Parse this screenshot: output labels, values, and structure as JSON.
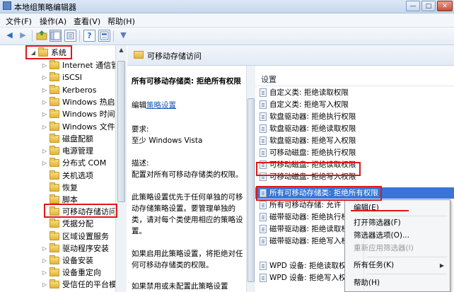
{
  "window": {
    "title": "本地组策略编辑器",
    "min": "—",
    "max": "□",
    "close": "✕"
  },
  "menu": [
    "文件(F)",
    "操作(A)",
    "查看(V)",
    "帮助(H)"
  ],
  "toolbar": {
    "back": "◀",
    "forward": "▶",
    "help": "?",
    "filter": "▼"
  },
  "tree": {
    "root": "系统",
    "items": [
      "Internet 通信管理",
      "iSCSI",
      "Kerberos",
      "Windows 热启动",
      "Windows 时间服务",
      "Windows 文件保护",
      "磁盘配额",
      "电源管理",
      "分布式 COM",
      "关机选项",
      "恢复",
      "脚本",
      "可移动存储访问",
      "凭据分配",
      "区域设置服务",
      "驱动程序安装",
      "设备安装",
      "设备重定向",
      "受信任的平台模块服务"
    ]
  },
  "header": {
    "title": "可移动存储访问"
  },
  "description": {
    "heading": "所有可移动存储类: 拒绝所有权限",
    "edit_prefix": "编辑",
    "edit_link": "策略设置",
    "req_label": "要求:",
    "req_value": "至少 Windows Vista",
    "desc_label": "描述:",
    "desc_text": "配置对所有可移动存储类的权限。",
    "para2": "此策略设置优先于任何单独的可移动存储策略设置。要管理单独的类，请对每个类使用相应的策略设置。",
    "para3": "如果启用此策略设置，将拒绝对任何可移动存储类的权限。",
    "para4": "如果禁用或未配置此策略设置"
  },
  "list": {
    "column": "设置",
    "rows": [
      "自定义类: 拒绝读取权限",
      "自定义类: 拒绝写入权限",
      "软盘驱动器: 拒绝执行权限",
      "软盘驱动器: 拒绝读取权限",
      "软盘驱动器: 拒绝写入权限",
      "可移动磁盘: 拒绝执行权限",
      "可移动磁盘: 拒绝读取权限",
      "可移动磁盘: 拒绝写入权限",
      "所有可移动存储类: 拒绝所有权限",
      "所有可移动存储: 允许",
      "磁带驱动器: 拒绝执行权限",
      "磁带驱动器: 拒绝读取权限",
      "磁带驱动器: 拒绝写入权限",
      "WPD 设备: 拒绝读取权限",
      "WPD 设备: 拒绝写入权限"
    ]
  },
  "context_menu": {
    "items": [
      "编辑(E)",
      "打开筛选器(F)",
      "筛选器选项(O)...",
      "重新应用筛选器(I)",
      "所有任务(K)",
      "帮助(H)"
    ],
    "submenu_arrow": "▶"
  },
  "colors": {
    "selection": "#3875d7",
    "annotation": "#e01818",
    "link": "#1b57b8"
  }
}
